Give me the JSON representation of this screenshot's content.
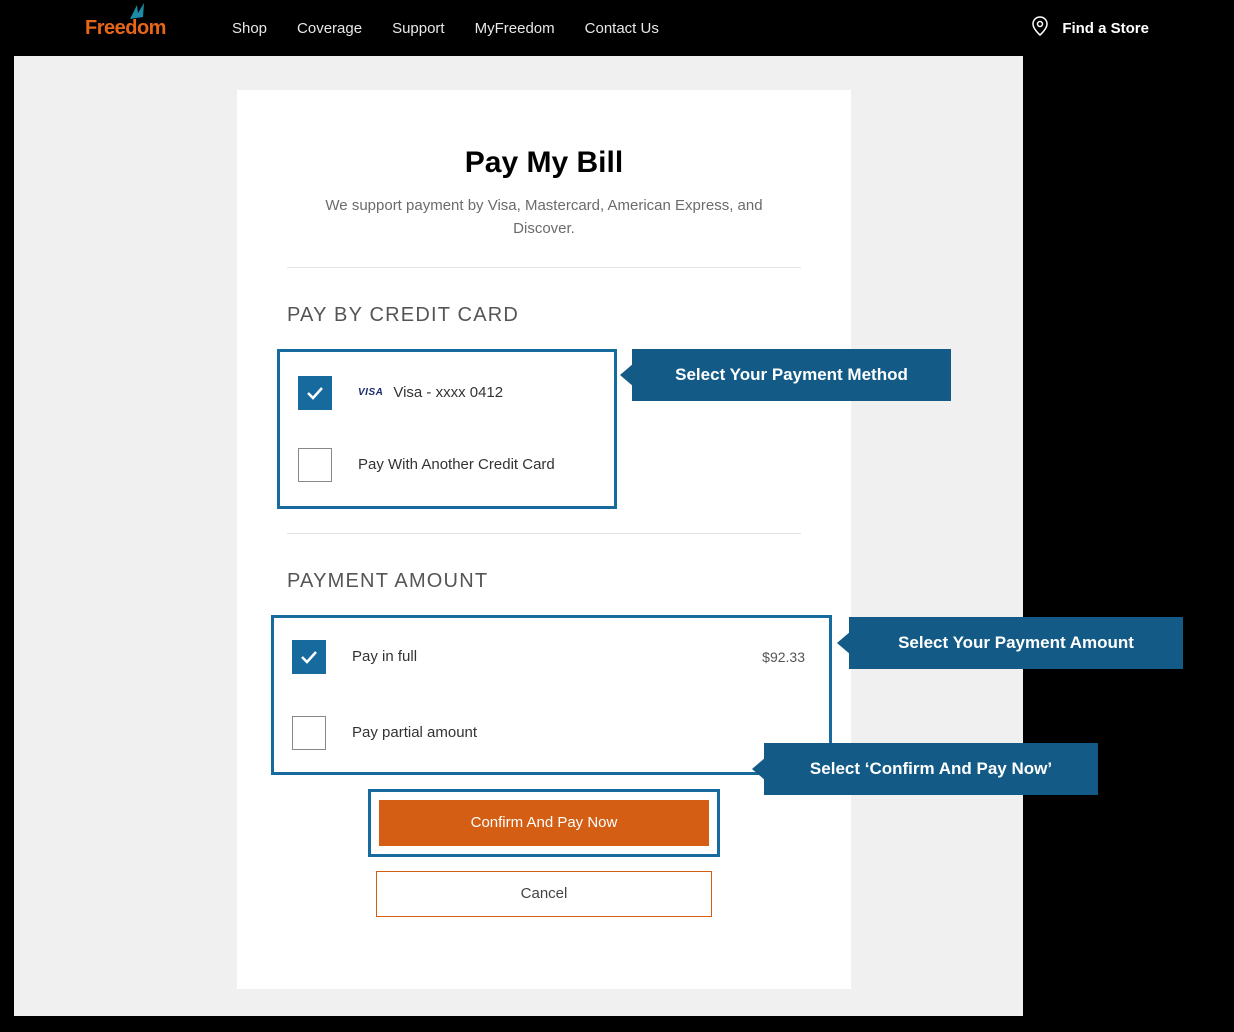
{
  "brand": {
    "name": "Freedom"
  },
  "nav": {
    "items": [
      "Shop",
      "Coverage",
      "Support",
      "MyFreedom",
      "Contact Us"
    ],
    "find_store": "Find a Store"
  },
  "page": {
    "title": "Pay My Bill",
    "subhead": "We support payment by Visa, Mastercard, American Express, and Discover."
  },
  "pay_method": {
    "section_title": "PAY BY CREDIT CARD",
    "option_saved": {
      "brand": "VISA",
      "label": "Visa - xxxx 0412"
    },
    "option_other": {
      "label": "Pay With Another Credit Card"
    }
  },
  "amount": {
    "section_title": "PAYMENT AMOUNT",
    "full": {
      "label": "Pay in full",
      "value": "$92.33"
    },
    "partial": {
      "label": "Pay partial amount"
    }
  },
  "buttons": {
    "confirm": "Confirm And Pay Now",
    "cancel": "Cancel"
  },
  "callouts": {
    "method": "Select Your Payment Method",
    "amount": "Select Your Payment Amount",
    "confirm": "Select ‘Confirm And Pay Now’"
  }
}
